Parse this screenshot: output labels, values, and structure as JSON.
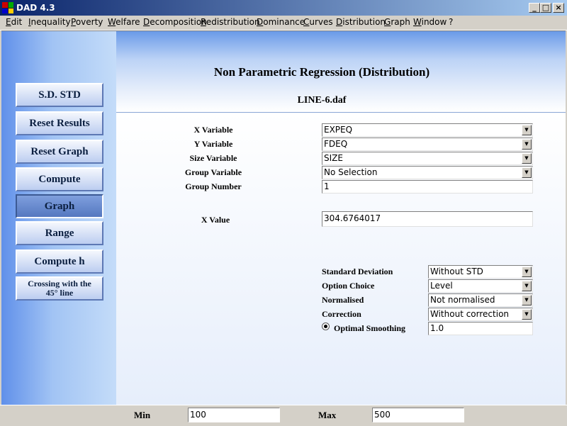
{
  "window": {
    "title": "DAD 4.3"
  },
  "menu": [
    "Edit",
    "Inequality",
    "Poverty",
    "Welfare",
    "Decomposition",
    "Redistribution",
    "Dominance",
    "Curves",
    "Distribution",
    "Graph",
    "Window",
    "?"
  ],
  "sidebar": {
    "sd_std": "S.D. STD",
    "reset_results": "Reset Results",
    "reset_graph": "Reset Graph",
    "compute": "Compute",
    "graph": "Graph",
    "range": "Range",
    "compute_h": "Compute h",
    "crossing_line1": "Crossing with the",
    "crossing_line2": "45° line"
  },
  "header": {
    "title": "Non Parametric Regression (Distribution)",
    "file": "LINE-6.daf"
  },
  "form": {
    "x_variable": {
      "label": "X Variable",
      "value": "EXPEQ"
    },
    "y_variable": {
      "label": "Y Variable",
      "value": "FDEQ"
    },
    "size_variable": {
      "label": "Size Variable",
      "value": "SIZE"
    },
    "group_variable": {
      "label": "Group Variable",
      "value": "No Selection"
    },
    "group_number": {
      "label": "Group Number",
      "value": "1"
    },
    "x_value": {
      "label": "X Value",
      "value": "304.6764017"
    }
  },
  "options": {
    "standard_deviation": {
      "label": "Standard Deviation",
      "value": "Without STD"
    },
    "option_choice": {
      "label": "Option Choice",
      "value": "Level"
    },
    "normalised": {
      "label": "Normalised",
      "value": "Not normalised"
    },
    "correction": {
      "label": "Correction",
      "value": "Without correction"
    },
    "optimal_smoothing": {
      "label": "Optimal Smoothing",
      "value": "1.0"
    }
  },
  "status": {
    "min_label": "Min",
    "min_value": "100",
    "max_label": "Max",
    "max_value": "500"
  }
}
